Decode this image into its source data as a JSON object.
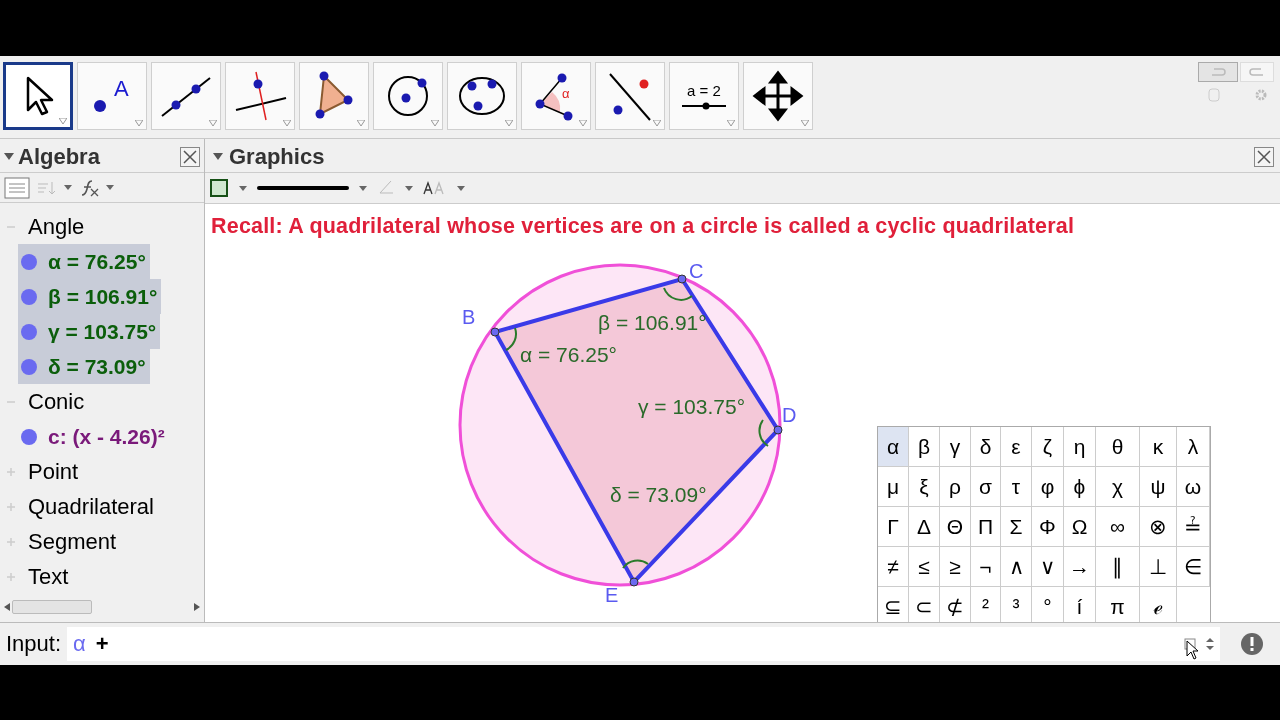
{
  "toolbar": {
    "tools": [
      {
        "kind": "move",
        "selected": true
      },
      {
        "kind": "point",
        "label": "A",
        "selected": false
      },
      {
        "kind": "line",
        "selected": false
      },
      {
        "kind": "perpendicular",
        "selected": false
      },
      {
        "kind": "polygon",
        "selected": false
      },
      {
        "kind": "circle",
        "selected": false
      },
      {
        "kind": "conic",
        "selected": false
      },
      {
        "kind": "angle",
        "label": "α",
        "selected": false
      },
      {
        "kind": "reflect",
        "selected": false
      },
      {
        "kind": "slider",
        "label": "a = 2",
        "selected": false
      },
      {
        "kind": "move-view",
        "selected": false
      }
    ]
  },
  "algebra": {
    "title": "Algebra",
    "groups": [
      {
        "label": "Angle",
        "expanded": true,
        "children": [
          {
            "text": "α = 76.25°",
            "color": "#0b5e0b",
            "selected": true
          },
          {
            "text": "β = 106.91°",
            "color": "#0b5e0b",
            "selected": true
          },
          {
            "text": "γ = 103.75°",
            "color": "#0b5e0b",
            "selected": true
          },
          {
            "text": "δ = 73.09°",
            "color": "#0b5e0b",
            "selected": true
          }
        ]
      },
      {
        "label": "Conic",
        "expanded": true,
        "children": [
          {
            "text": "c: (x - 4.26)²",
            "color": "#7a1a7a",
            "selected": false
          }
        ]
      },
      {
        "label": "Point",
        "expanded": false
      },
      {
        "label": "Quadrilateral",
        "expanded": false
      },
      {
        "label": "Segment",
        "expanded": false
      },
      {
        "label": "Text",
        "expanded": false
      }
    ]
  },
  "graphics": {
    "title": "Graphics",
    "note": "Recall: A quadrilateral whose vertices are on a circle is called a cyclic quadrilateral",
    "points": [
      "B",
      "C",
      "D",
      "E"
    ],
    "angles": [
      "α = 76.25°",
      "β = 106.91°",
      "γ = 103.75°",
      "δ = 73.09°"
    ]
  },
  "symbols": {
    "rows": [
      [
        {
          "symbol": "α",
          "selected": true
        },
        {
          "symbol": "β",
          "selected": false
        },
        {
          "symbol": "γ",
          "selected": false
        },
        {
          "symbol": "δ",
          "selected": false
        },
        {
          "symbol": "ε",
          "selected": false
        },
        {
          "symbol": "ζ",
          "selected": false
        },
        {
          "symbol": "η",
          "selected": false
        },
        {
          "symbol": "θ",
          "selected": false
        },
        {
          "symbol": "κ",
          "selected": false
        },
        {
          "symbol": "λ",
          "selected": false
        }
      ],
      [
        {
          "symbol": "μ",
          "selected": false
        },
        {
          "symbol": "ξ",
          "selected": false
        },
        {
          "symbol": "ρ",
          "selected": false
        },
        {
          "symbol": "σ",
          "selected": false
        },
        {
          "symbol": "τ",
          "selected": false
        },
        {
          "symbol": "φ",
          "selected": false
        },
        {
          "symbol": "ϕ",
          "selected": false
        },
        {
          "symbol": "χ",
          "selected": false
        },
        {
          "symbol": "ψ",
          "selected": false
        },
        {
          "symbol": "ω",
          "selected": false
        }
      ],
      [
        {
          "symbol": "Γ",
          "selected": false
        },
        {
          "symbol": "Δ",
          "selected": false
        },
        {
          "symbol": "Θ",
          "selected": false
        },
        {
          "symbol": "Π",
          "selected": false
        },
        {
          "symbol": "Σ",
          "selected": false
        },
        {
          "symbol": "Φ",
          "selected": false
        },
        {
          "symbol": "Ω",
          "selected": false
        },
        {
          "symbol": "∞",
          "selected": false
        },
        {
          "symbol": "⊗",
          "selected": false
        },
        {
          "symbol": "≟",
          "selected": false
        }
      ],
      [
        {
          "symbol": "≠",
          "selected": false
        },
        {
          "symbol": "≤",
          "selected": false
        },
        {
          "symbol": "≥",
          "selected": false
        },
        {
          "symbol": "¬",
          "selected": false
        },
        {
          "symbol": "∧",
          "selected": false
        },
        {
          "symbol": "∨",
          "selected": false
        },
        {
          "symbol": "→",
          "selected": false
        },
        {
          "symbol": "∥",
          "selected": false
        },
        {
          "symbol": "⊥",
          "selected": false
        },
        {
          "symbol": "∈",
          "selected": false
        }
      ],
      [
        {
          "symbol": "⊆",
          "selected": false
        },
        {
          "symbol": "⊂",
          "selected": false
        },
        {
          "symbol": "⊄",
          "selected": false
        },
        {
          "symbol": "²",
          "selected": false
        },
        {
          "symbol": "³",
          "selected": false
        },
        {
          "symbol": "°",
          "selected": false
        },
        {
          "symbol": "í",
          "selected": false
        },
        {
          "symbol": "π",
          "selected": false
        },
        {
          "symbol": "ℯ",
          "selected": false
        }
      ]
    ]
  },
  "input": {
    "label": "Input:",
    "value_parts": [
      "α",
      "+"
    ]
  }
}
